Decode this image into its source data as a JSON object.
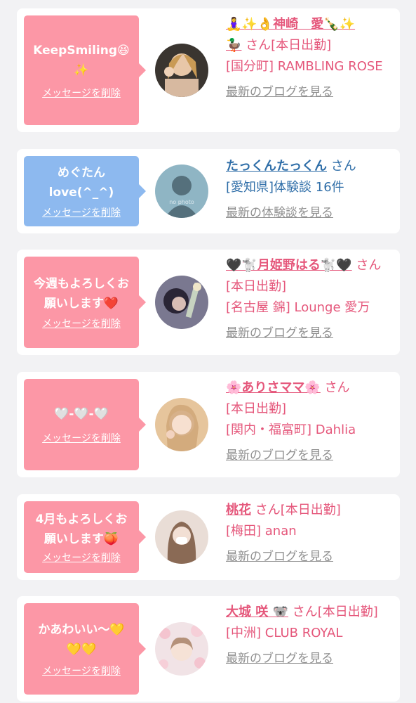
{
  "delete_label": "メッセージを削除",
  "colors": {
    "pink_bubble": "#fc97a6",
    "blue_bubble": "#8db9ef",
    "pink_text": "#e5577b",
    "blue_text": "#2f6ea8",
    "gray_link": "#8f8f8f"
  },
  "cards": [
    {
      "message": "KeepSmiling😆\n✨",
      "name": "🧘‍♀️✨👌神崎　愛🍾✨\n🦆",
      "san": "さん",
      "line1": "[本日出勤]",
      "line2": "[国分町] RAMBLING ROSE",
      "link": "最新のブログを見る"
    },
    {
      "message": "めぐたん\nlove(^_^)",
      "name": "たっくんたっくん",
      "san": "さん",
      "line1": "[愛知県]体験談 16件",
      "line2": "",
      "link": "最新の体験談を見る",
      "avatar_text": "no photo"
    },
    {
      "message": "今週もよろしくお\n願いします❤️",
      "name": "🖤🐩月姫野はる🐩🖤",
      "san": "さん",
      "line1": "[本日出勤]",
      "line2": "[名古屋 錦] Lounge 愛万",
      "link": "最新のブログを見る"
    },
    {
      "message": "🤍-🤍-🤍",
      "name": "🌸ありさママ🌸",
      "san": "さん",
      "line1": "[本日出勤]",
      "line2": "[関内・福富町] Dahlia",
      "link": "最新のブログを見る"
    },
    {
      "message": "4月もよろしくお\n願いします🍑",
      "name": "桃花",
      "san": "さん",
      "line1": "[本日出勤]",
      "line2": "[梅田] anan",
      "link": "最新のブログを見る"
    },
    {
      "message": "かあわいい〜💛\n💛💛",
      "name": "大城 咲 🐨",
      "san": "さん",
      "line1": "[本日出勤]",
      "line2": "[中洲] CLUB ROYAL",
      "link": "最新のブログを見る"
    }
  ]
}
